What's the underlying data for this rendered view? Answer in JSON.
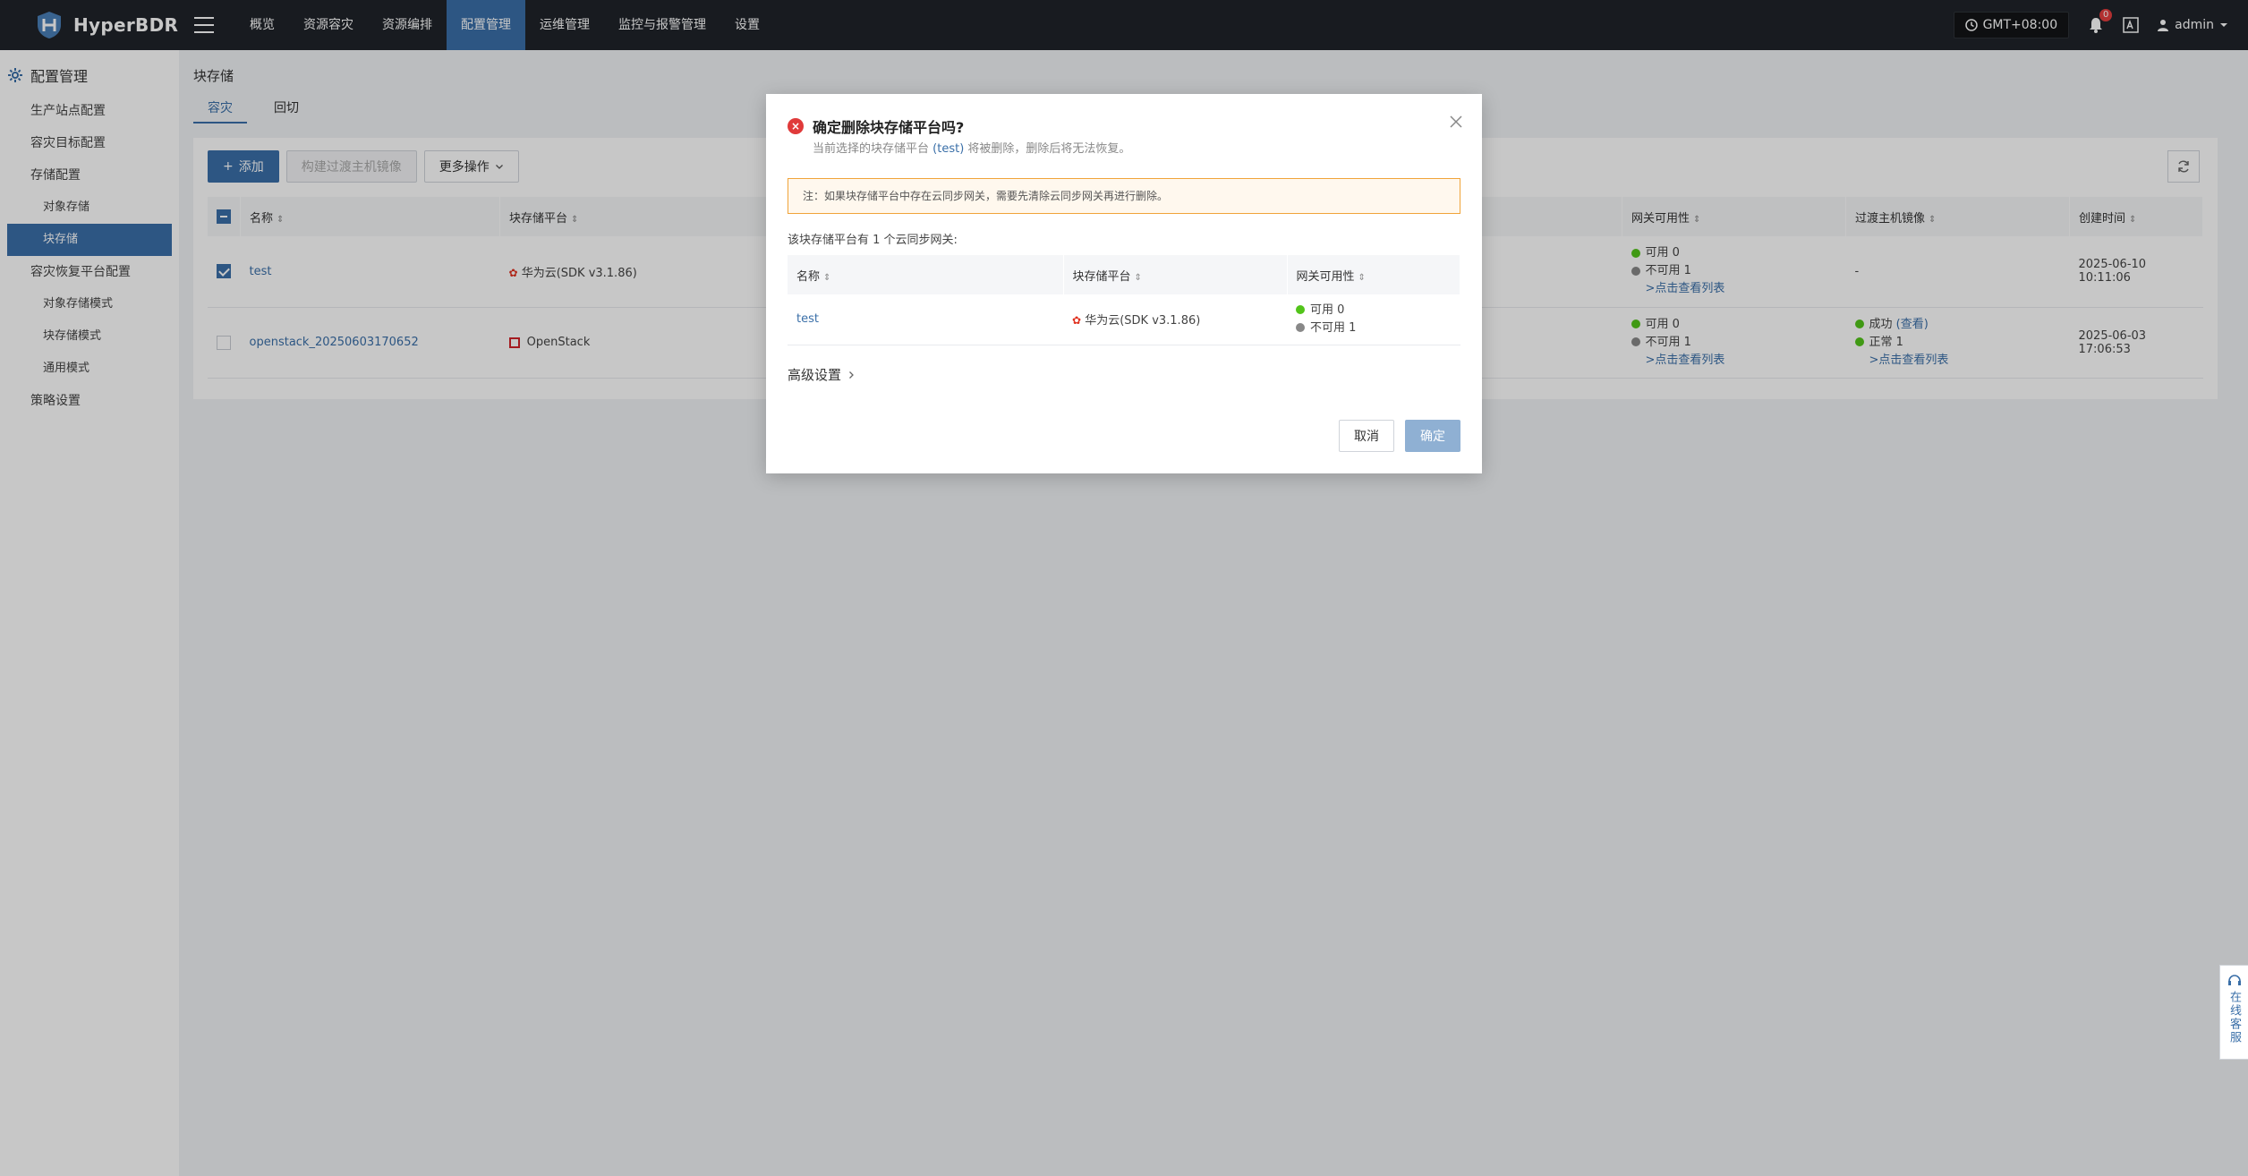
{
  "app": {
    "name": "HyperBDR"
  },
  "nav": [
    "概览",
    "资源容灾",
    "资源编排",
    "配置管理",
    "运维管理",
    "监控与报警管理",
    "设置"
  ],
  "topbar": {
    "timezone": "GMT+08:00",
    "notifications": "0",
    "user": "admin"
  },
  "sidebar": {
    "heading": "配置管理",
    "items": {
      "production_site": "生产站点配置",
      "dr_target": "容灾目标配置",
      "storage_config": "存储配置",
      "object_storage": "对象存储",
      "block_storage": "块存储",
      "dr_recovery_platform": "容灾恢复平台配置",
      "object_storage_mode": "对象存储模式",
      "block_storage_mode": "块存储模式",
      "general_mode": "通用模式",
      "policy": "策略设置"
    }
  },
  "page": {
    "title": "块存储",
    "tabs": [
      "容灾",
      "回切"
    ]
  },
  "toolbar": {
    "add": "添加",
    "build_image": "构建过渡主机镜像",
    "more": "更多操作"
  },
  "table": {
    "columns": {
      "name": "名称",
      "platform": "块存储平台",
      "gateway": "网关可用性",
      "image": "过渡主机镜像",
      "created": "创建时间"
    },
    "rows": [
      {
        "name": "test",
        "platform": "华为云(SDK v3.1.86)",
        "gw_ok": "可用 0",
        "gw_bad": "不可用 1",
        "gw_link": ">点击查看列表",
        "image_status": "-",
        "image_view": "",
        "image_normal": "",
        "image_link": "",
        "created": "2025-06-10 10:11:06"
      },
      {
        "name": "openstack_20250603170652",
        "platform": "OpenStack",
        "gw_ok": "可用 0",
        "gw_bad": "不可用 1",
        "gw_link": ">点击查看列表",
        "image_status": "成功",
        "image_view": "(查看)",
        "image_normal": "正常 1",
        "image_link": ">点击查看列表",
        "created": "2025-06-03 17:06:53"
      }
    ]
  },
  "modal": {
    "title": "确定删除块存储平台吗?",
    "subtitle_prefix": "当前选择的块存储平台",
    "subtitle_name": "(test)",
    "subtitle_suffix": "将被删除，删除后将无法恢复。",
    "warning": "注：如果块存储平台中存在云同步网关，需要先清除云同步网关再进行删除。",
    "count_line": "该块存储平台有 1 个云同步网关:",
    "inner_columns": {
      "name": "名称",
      "platform": "块存储平台",
      "gateway": "网关可用性"
    },
    "inner_rows": [
      {
        "name": "test",
        "platform": "华为云(SDK v3.1.86)",
        "gw_ok": "可用 0",
        "gw_bad": "不可用 1"
      }
    ],
    "advanced": "高级设置",
    "cancel": "取消",
    "confirm": "确定"
  },
  "service": {
    "label": "在线客服"
  },
  "colors": {
    "primary": "#3a6fa8",
    "topbar": "#1f2329",
    "error": "#e03a3a",
    "ok": "#52c41a"
  }
}
